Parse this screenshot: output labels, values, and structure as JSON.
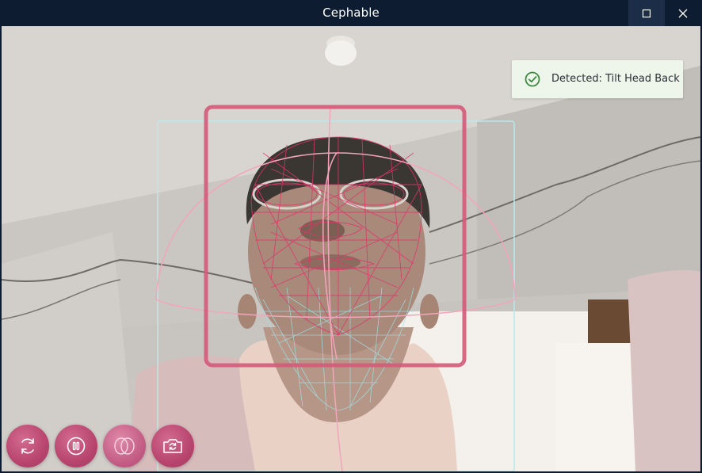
{
  "window": {
    "title": "Cephable",
    "maximize_icon": "maximize-icon",
    "close_icon": "close-icon"
  },
  "notification": {
    "icon": "check-circle-icon",
    "text": "Detected: Tilt Head Back",
    "accent_color": "#3d8a43"
  },
  "controls": [
    {
      "name": "refresh-button",
      "icon": "refresh-icon"
    },
    {
      "name": "pause-button",
      "icon": "pause-icon"
    },
    {
      "name": "face-mesh-toggle-button",
      "icon": "face-overlay-icon"
    },
    {
      "name": "switch-camera-button",
      "icon": "camera-switch-icon"
    }
  ],
  "colors": {
    "titlebar": "#0d1c31",
    "control_button": "#b8456e",
    "face_box": "#d45a7a",
    "mesh_lower": "#9fe0e6"
  }
}
